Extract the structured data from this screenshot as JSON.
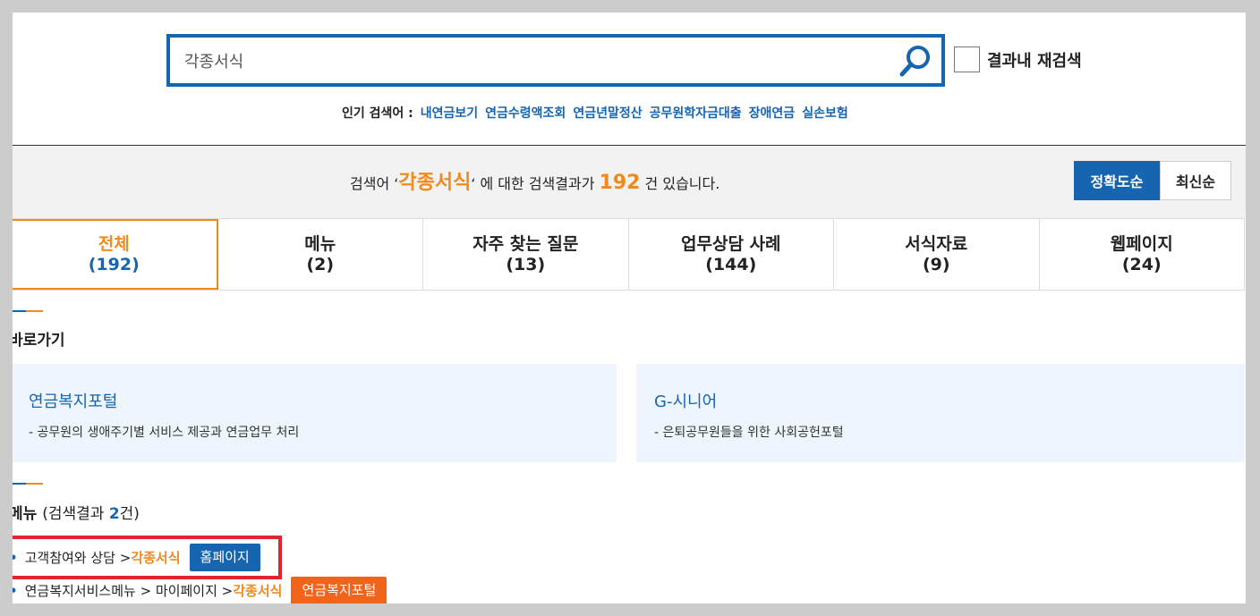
{
  "search": {
    "value": "각종서식",
    "recheck_label": "결과내 재검색"
  },
  "popular": {
    "label": "인기 검색어 :",
    "terms": [
      "내연금보기",
      "연금수령액조회",
      "연금년말정산",
      "공무원학자금대출",
      "장애연금",
      "실손보험"
    ]
  },
  "result": {
    "prefix": "검색어 ‘",
    "keyword": "각종서식",
    "middle": "‘ 에 대한 검색결과가 ",
    "count": "192",
    "suffix": " 건 있습니다."
  },
  "sort": {
    "options": [
      "정확도순",
      "최신순"
    ],
    "selected": "정확도순"
  },
  "tabs": [
    {
      "label": "전체",
      "count": "(192)"
    },
    {
      "label": "메뉴",
      "count": "(2)"
    },
    {
      "label": "자주 찾는 질문",
      "count": "(13)"
    },
    {
      "label": "업무상담 사례",
      "count": "(144)"
    },
    {
      "label": "서식자료",
      "count": "(9)"
    },
    {
      "label": "웹페이지",
      "count": "(24)"
    }
  ],
  "shortcuts": {
    "title": "바로가기",
    "cards": [
      {
        "title": "연금복지포털",
        "desc": "- 공무원의 생애주기별 서비스 제공과 연금업무 처리"
      },
      {
        "title": "G-시니어",
        "desc": "- 은퇴공무원들을 위한 사회공헌포털"
      }
    ]
  },
  "menu_section": {
    "title": "메뉴",
    "sub_open": "(검색결과 ",
    "count": "2",
    "sub_close": "건)",
    "items": [
      {
        "path": "고객참여와 상담 > ",
        "highlight": "각종서식",
        "tag": "홈페이지"
      },
      {
        "path": "연금복지서비스메뉴 > 마이페이지 > ",
        "highlight": "각종서식",
        "tag": "연금복지포털"
      }
    ]
  },
  "colors": {
    "accent_blue": "#1565b0",
    "accent_orange": "#f08a1c",
    "highlight_red": "#e4232b"
  }
}
